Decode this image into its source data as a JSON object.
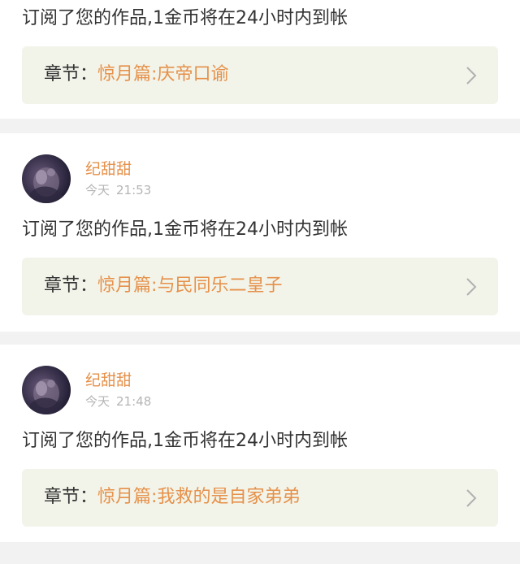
{
  "notifications": [
    {
      "message": "订阅了您的作品,1金币将在24小时内到帐",
      "chapter_label": "章节",
      "chapter_colon": "：",
      "chapter_title": "惊月篇:庆帝口谕"
    },
    {
      "username": "纪甜甜",
      "time_day": "今天",
      "time_clock": "21:53",
      "message": "订阅了您的作品,1金币将在24小时内到帐",
      "chapter_label": "章节",
      "chapter_colon": "：",
      "chapter_title": "惊月篇:与民同乐二皇子"
    },
    {
      "username": "纪甜甜",
      "time_day": "今天",
      "time_clock": "21:48",
      "message": "订阅了您的作品,1金币将在24小时内到帐",
      "chapter_label": "章节",
      "chapter_colon": "：",
      "chapter_title": "惊月篇:我救的是自家弟弟"
    }
  ],
  "colors": {
    "accent": "#e6914a",
    "chapter_bg": "#f2f4ea",
    "text": "#333333",
    "muted": "#b5b5b5",
    "page_bg": "#f2f2f2"
  },
  "icons": {
    "chevron": "chevron-right-icon",
    "avatar": "avatar"
  }
}
